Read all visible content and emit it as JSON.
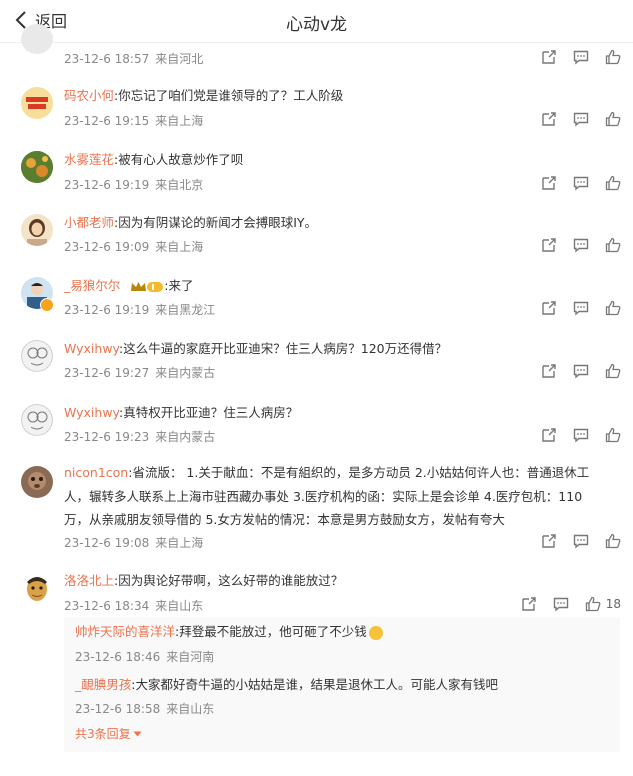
{
  "header": {
    "back_label": "返回",
    "title": "心动v龙"
  },
  "comments": [
    {
      "user": "",
      "text": "",
      "time": "23-12-6 18:57",
      "location": "来自河北"
    },
    {
      "user": "码农小何",
      "text": ":你忘记了咱们党是谁领导的了？工人阶级",
      "time": "23-12-6 19:15",
      "location": "来自上海"
    },
    {
      "user": "水雾莲花",
      "text": ":被有心人故意炒作了呗",
      "time": "23-12-6 19:19",
      "location": "来自北京"
    },
    {
      "user": "小都老师",
      "text": ":因为有阴谋论的新闻才会搏眼球IY。",
      "time": "23-12-6 19:09",
      "location": "来自上海"
    },
    {
      "user": "_易狼尔尔",
      "text": ":来了",
      "time": "23-12-6 19:19",
      "location": "来自黑龙江"
    },
    {
      "user": "Wyxihwy",
      "text": ":这么牛逼的家庭开比亚迪宋？住三人病房？120万还得借？",
      "time": "23-12-6 19:27",
      "location": "来自内蒙古"
    },
    {
      "user": "Wyxihwy",
      "text": ":真特权开比亚迪？住三人病房？",
      "time": "23-12-6 19:23",
      "location": "来自内蒙古"
    },
    {
      "user": "nicon1con",
      "text_line1": ":省流版： 1.关于献血：不是有組织的，是多方动员 2.小姑姑何许人也：普通退休工",
      "text_line2": "人，辗转多人联系上上海市驻西藏办事处 3.医疗机构的函：实际上是会诊单 4.医疗包机：110",
      "text_line3": "万，从亲戚朋友领导借的 5.女方发帖的情况：本意是男方鼓励女方，发帖有夸大",
      "time": "23-12-6 19:08",
      "location": "来自上海"
    },
    {
      "user": "洛洛北上",
      "text": ":因为舆论好带啊，这么好带的谁能放过？",
      "time": "23-12-6 18:34",
      "location": "来自山东",
      "likes": "18"
    }
  ],
  "replies": [
    {
      "user": "帅炸天际的喜洋洋",
      "text": ":拜登最不能放过，他可砸了不少钱",
      "time": "23-12-6 18:46",
      "location": "来自河南"
    },
    {
      "user": "_靦腆男孩",
      "text": ":大家都好奇牛逼的小姑姑是谁，结果是退休工人。可能人家有钱吧",
      "time": "23-12-6 18:58",
      "location": "来自山东"
    }
  ],
  "more_replies": "共3条回复",
  "icons": {
    "share": "share-icon",
    "comment": "comment-icon",
    "like": "like-icon"
  },
  "colors": {
    "username": "#eb7350",
    "meta": "#888888"
  }
}
